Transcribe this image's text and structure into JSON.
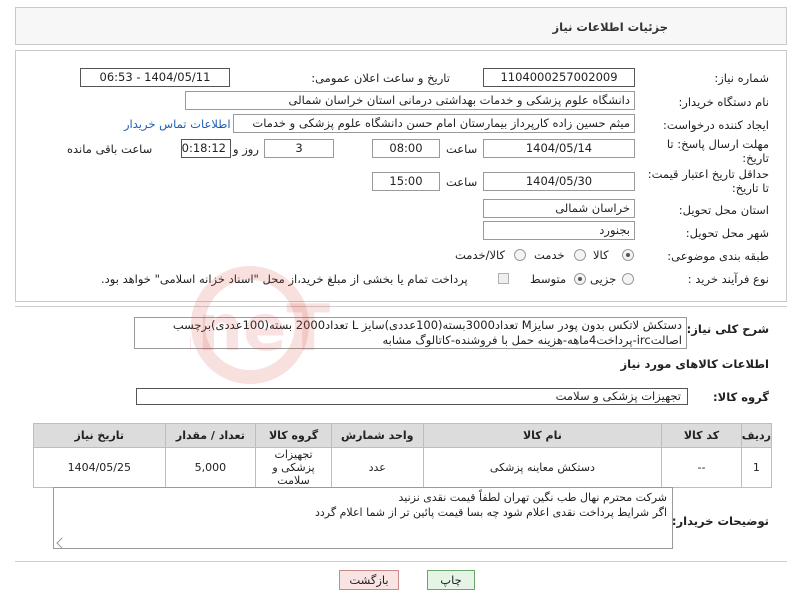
{
  "header": {
    "title": "جزئیات اطلاعات نیاز"
  },
  "form": {
    "need_number_label": "شماره نیاز:",
    "need_number": "1104000257002009",
    "announce_label": "تاریخ و ساعت اعلان عمومی:",
    "announce_value": "1404/05/11 - 06:53",
    "buyer_org_label": "نام دستگاه خریدار:",
    "buyer_org": "دانشگاه علوم پزشکی و خدمات بهداشتی درمانی استان خراسان شمالی",
    "requester_label": "ایجاد کننده درخواست:",
    "requester": "میثم  حسین زاده  کارپرداز بیمارستان امام حسن دانشگاه علوم پزشکی و خدمات",
    "contact_link": "اطلاعات تماس خریدار",
    "deadline_label_1": "مهلت ارسال پاسخ: تا",
    "deadline_label_2": "تاریخ:",
    "deadline_date": "1404/05/14",
    "time_label": "ساعت",
    "deadline_time": "08:00",
    "days_value": "3",
    "days_label": "روز و",
    "remaining_time": "00:18:12",
    "remaining_label": "ساعت باقی مانده",
    "validity_label_1": "حداقل تاریخ اعتبار قیمت:",
    "validity_label_2": "تا تاریخ:",
    "validity_date": "1404/05/30",
    "validity_time": "15:00",
    "province_label": "استان محل تحویل:",
    "province": "خراسان شمالی",
    "city_label": "شهر محل تحویل:",
    "city": "بجنورد",
    "category_label": "طبقه بندی موضوعی:",
    "category_options": [
      "کالا",
      "خدمت",
      "کالا/خدمت"
    ],
    "category_selected": "کالا",
    "process_label": "نوع فرآیند خرید :",
    "process_options": [
      "جزیی",
      "متوسط"
    ],
    "process_selected": "متوسط",
    "payment_note": "پرداخت تمام یا بخشی از مبلغ خرید،از محل \"اسناد خزانه اسلامی\" خواهد بود."
  },
  "description": {
    "label": "شرح کلی نیاز:",
    "text": "دستکش لاتکس بدون پودر سایزM تعداد3000بسته(100عددی)سایز L تعداد2000 بسته(100عددی)برچسب اصالتirc-پرداخت4ماهه-هزینه حمل با فروشنده-کاتالوگ مشابه"
  },
  "goods_info": {
    "title": "اطلاعات کالاهای مورد نیاز",
    "group_label": "گروه کالا:",
    "group_value": "تجهیزات پزشکی و سلامت"
  },
  "table": {
    "columns": [
      "ردیف",
      "کد کالا",
      "نام کالا",
      "واحد شمارش",
      "گروه کالا",
      "تعداد / مقدار",
      "تاریخ نیاز"
    ],
    "rows": [
      [
        "1",
        "--",
        "دستکش معاینه پزشکی",
        "عدد",
        "تجهیزات پزشکی و سلامت",
        "5,000",
        "1404/05/25"
      ]
    ]
  },
  "buyer_notes": {
    "label": "توضیحات خریدار:",
    "line1": "شرکت محترم نهال طب نگین تهران لطفاً قیمت نقدی نزنید",
    "line2": "اگر شرایط پرداخت نقدی اعلام شود چه بسا قیمت پائین تر از شما اعلام گردد"
  },
  "buttons": {
    "print": "چاپ",
    "back": "بازگشت"
  },
  "watermark": {
    "text": "AriaTender.neT"
  },
  "colors": {
    "link": "#1f5fb0",
    "print_bg": "#e6f4e6",
    "back_bg": "#f9e3e3",
    "table_header": "#dcdcdc",
    "watermark": "#d9534f"
  }
}
